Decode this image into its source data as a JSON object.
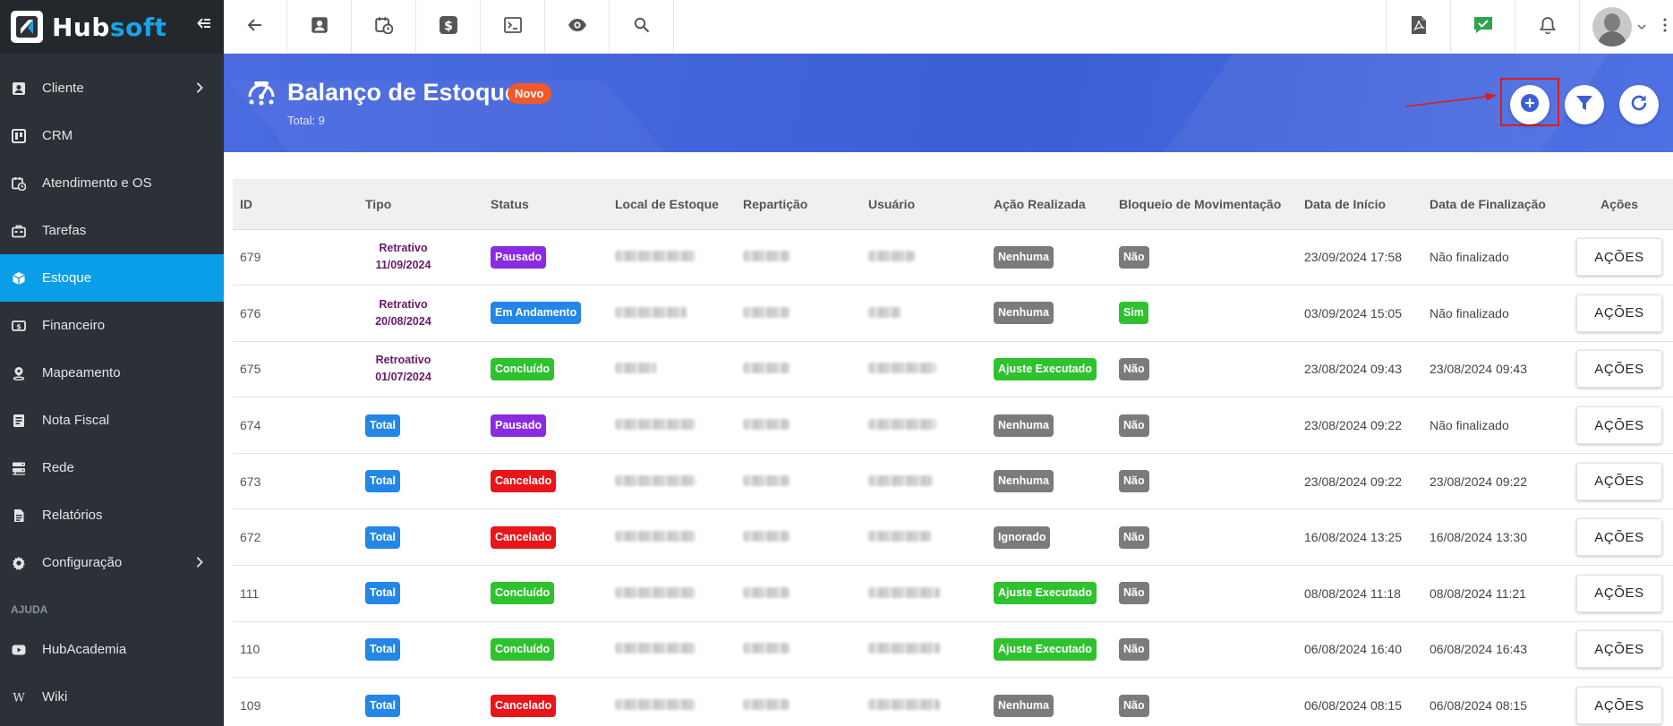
{
  "brand": {
    "name_part1": "Hub",
    "name_part2": "soft"
  },
  "sidebar": {
    "items": [
      {
        "label": "Cliente",
        "icon": "contact-card-icon",
        "has_submenu": true
      },
      {
        "label": "CRM",
        "icon": "kanban-board-icon",
        "has_submenu": false
      },
      {
        "label": "Atendimento e OS",
        "icon": "calendar-clock-icon",
        "has_submenu": false
      },
      {
        "label": "Tarefas",
        "icon": "briefcase-icon",
        "has_submenu": false
      },
      {
        "label": "Estoque",
        "icon": "cube-icon",
        "has_submenu": false,
        "active": true
      },
      {
        "label": "Financeiro",
        "icon": "money-icon",
        "has_submenu": false
      },
      {
        "label": "Mapeamento",
        "icon": "map-pin-icon",
        "has_submenu": false
      },
      {
        "label": "Nota Fiscal",
        "icon": "receipt-icon",
        "has_submenu": false
      },
      {
        "label": "Rede",
        "icon": "server-icon",
        "has_submenu": false
      },
      {
        "label": "Relatórios",
        "icon": "document-icon",
        "has_submenu": false
      },
      {
        "label": "Configuração",
        "icon": "gear-icon",
        "has_submenu": true
      }
    ],
    "section_label": "AJUDA",
    "help_items": [
      {
        "label": "HubAcademia",
        "icon": "youtube-icon"
      },
      {
        "label": "Wiki",
        "icon": "wikipedia-icon"
      }
    ]
  },
  "topbar": {
    "left_icons": [
      "back-arrow-icon",
      "contact-card-icon",
      "calendar-clock-icon",
      "dollar-icon",
      "terminal-icon",
      "eye-icon",
      "search-icon"
    ],
    "right_icons": [
      "pdf-file-icon",
      "checked-chat-icon",
      "bell-icon"
    ]
  },
  "header": {
    "title": "Balanço de Estoque",
    "badge": "Novo",
    "total": "Total: 9",
    "actions": [
      "add-circle-icon",
      "filter-icon",
      "refresh-icon"
    ]
  },
  "table": {
    "columns": [
      "ID",
      "Tipo",
      "Status",
      "Local de Estoque",
      "Repartição",
      "Usuário",
      "Ação Realizada",
      "Bloqueio de Movimentação",
      "Data de Início",
      "Data de Finalização",
      "Ações"
    ],
    "action_label": "AÇÕES",
    "rows": [
      {
        "id": "679",
        "tipo": "Retrativo",
        "tipo_date": "11/09/2024",
        "status": "Pausado",
        "acao": "Nenhuma",
        "bloqueio": "Não",
        "inicio": "23/09/2024 17:58",
        "fim": "Não finalizado"
      },
      {
        "id": "676",
        "tipo": "Retrativo",
        "tipo_date": "20/08/2024",
        "status": "Em Andamento",
        "acao": "Nenhuma",
        "bloqueio": "Sim",
        "inicio": "03/09/2024 15:05",
        "fim": "Não finalizado"
      },
      {
        "id": "675",
        "tipo": "Retroativo",
        "tipo_date": "01/07/2024",
        "status": "Concluído",
        "acao": "Ajuste Executado",
        "bloqueio": "Não",
        "inicio": "23/08/2024 09:43",
        "fim": "23/08/2024 09:43"
      },
      {
        "id": "674",
        "tipo": "Total",
        "tipo_date": "",
        "status": "Pausado",
        "acao": "Nenhuma",
        "bloqueio": "Não",
        "inicio": "23/08/2024 09:22",
        "fim": "Não finalizado"
      },
      {
        "id": "673",
        "tipo": "Total",
        "tipo_date": "",
        "status": "Cancelado",
        "acao": "Nenhuma",
        "bloqueio": "Não",
        "inicio": "23/08/2024 09:22",
        "fim": "23/08/2024 09:22"
      },
      {
        "id": "672",
        "tipo": "Total",
        "tipo_date": "",
        "status": "Cancelado",
        "acao": "Ignorado",
        "bloqueio": "Não",
        "inicio": "16/08/2024 13:25",
        "fim": "16/08/2024 13:30"
      },
      {
        "id": "111",
        "tipo": "Total",
        "tipo_date": "",
        "status": "Concluído",
        "acao": "Ajuste Executado",
        "bloqueio": "Não",
        "inicio": "08/08/2024 11:18",
        "fim": "08/08/2024 11:21"
      },
      {
        "id": "110",
        "tipo": "Total",
        "tipo_date": "",
        "status": "Concluído",
        "acao": "Ajuste Executado",
        "bloqueio": "Não",
        "inicio": "06/08/2024 16:40",
        "fim": "06/08/2024 16:43"
      },
      {
        "id": "109",
        "tipo": "Total",
        "tipo_date": "",
        "status": "Cancelado",
        "acao": "Nenhuma",
        "bloqueio": "Não",
        "inicio": "06/08/2024 08:15",
        "fim": "06/08/2024 08:15"
      }
    ]
  },
  "colors": {
    "sidebar_bg": "#2b3137",
    "accent": "#0a9ee9",
    "banner": "#4364dc",
    "badge_novo": "#f0592a",
    "status_pausado": "#8a2be2",
    "status_andamento": "#2287e6",
    "status_concluido": "#2ec22e",
    "status_cancelado": "#e8161a",
    "neutral_badge": "#7b7b7b",
    "highlight_box": "#e01b1b"
  }
}
